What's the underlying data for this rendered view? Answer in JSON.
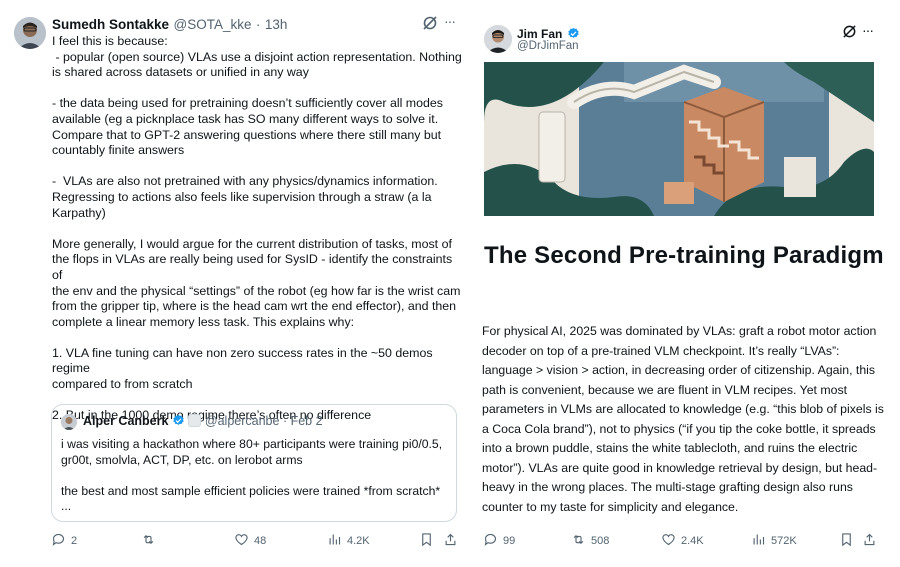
{
  "left": {
    "author_name": "Sumedh Sontakke",
    "author_handle": "@SOTA_kke",
    "separator": "·",
    "time": "13h",
    "more": "···",
    "text": "I feel this is because:\n - popular (open source) VLAs use a disjoint action representation. Nothing\nis shared across datasets or unified in any way\n\n- the data being used for pretraining doesn’t sufficiently cover all modes\navailable (eg a picknplace task has SO many different ways to solve it.\nCompare that to GPT-2 answering questions where there still many but\ncountably finite answers\n\n-  VLAs are also not pretrained with any physics/dynamics information.\nRegressing to actions also feels like supervision through a straw (a la\nKarpathy)\n\nMore generally, I would argue for the current distribution of tasks, most of\nthe flops in VLAs are really being used for SysID - identify the constraints of\nthe env and the physical “settings” of the robot (eg how far is the wrist cam\nfrom the gripper tip, where is the head cam wrt the end effector), and then\ncomplete a linear memory less task. This explains why:\n\n1. VLA fine tuning can have non zero success rates in the ~50 demos regime\ncompared to from scratch\n\n2. But in the 1000 demo regime there’s often no difference",
    "quote": {
      "author_name": "Alper Canberk",
      "author_handle": "@alpercanbe",
      "date": "· Feb 2",
      "text": "i was visiting a hackathon where 80+ participants were training pi0/0.5,\ngr00t, smolvla, ACT, DP, etc. on lerobot arms\n\nthe best and most sample efficient policies were trained *from scratch*\n..."
    },
    "actions": {
      "replies": "2",
      "retweets": "",
      "likes": "48",
      "views": "4.2K"
    }
  },
  "right": {
    "author_name": "Jim Fan",
    "author_handle": "@DrJimFan",
    "more": "···",
    "article_title": "The Second Pre-training Paradigm",
    "article_body": "For physical AI, 2025 was dominated by VLAs: graft a robot motor action decoder on top of a pre-trained VLM checkpoint. It’s really “LVAs”: language > vision > action, in decreasing order of citizenship. Again, this path is convenient, because we are fluent in VLM recipes. Yet most parameters in VLMs are allocated to knowledge (e.g. “this blob of pixels is a Coca Cola brand”), not to physics (“if you tip the coke bottle, it spreads into a brown puddle, stains the white tablecloth, and ruins the electric motor”). VLAs are quite good in knowledge retrieval by design, but head-heavy in the wrong places. The multi-stage grafting design also runs counter to my taste for simplicity and elegance.",
    "actions": {
      "replies": "99",
      "retweets": "508",
      "likes": "2.4K",
      "views": "572K"
    }
  },
  "colors": {
    "text": "#0f1419",
    "muted": "#536471",
    "verified": "#1d9bf0",
    "border": "#cfd9de"
  },
  "icons": [
    "grok-icon",
    "more-icon",
    "reply-icon",
    "retweet-icon",
    "like-icon",
    "views-icon",
    "bookmark-icon",
    "share-icon",
    "verified-badge-icon"
  ]
}
